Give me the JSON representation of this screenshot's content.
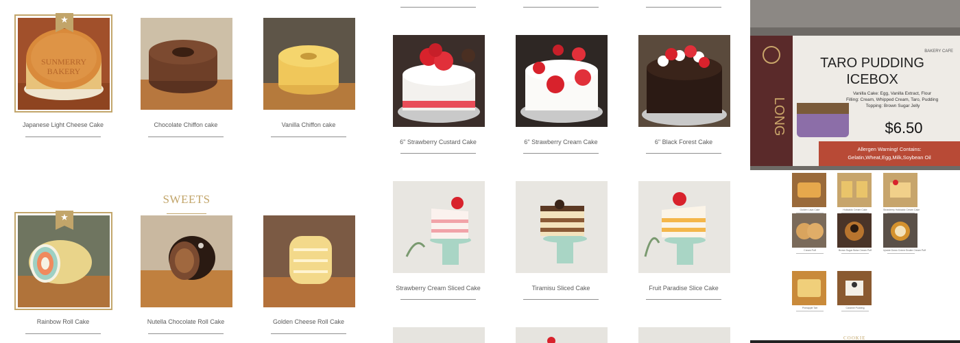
{
  "colors": {
    "gold": "#c2a56a",
    "label_text": "#5a5a5a",
    "rule": "#8e8e8e"
  },
  "panel_a": {
    "section_title": "SWEETS",
    "cards": [
      {
        "label": "Japanese Light Cheese Cake",
        "featured": true,
        "badge_icon": "star-icon",
        "badge": "★"
      },
      {
        "label": "Chocolate Chiffon cake"
      },
      {
        "label": "Vanilla Chiffon cake"
      },
      {
        "label": "Rainbow Roll Cake",
        "featured": true,
        "badge_icon": "star-icon",
        "badge": "★"
      },
      {
        "label": "Nutella Chocolate Roll Cake"
      },
      {
        "label": "Golden Cheese Roll Cake"
      }
    ]
  },
  "panel_b": {
    "cards": [
      {
        "label": "6\" Strawberry Custard Cake"
      },
      {
        "label": "6\" Strawberry Cream Cake"
      },
      {
        "label": "6\" Black Forest Cake"
      },
      {
        "label": "Strawberry Cream Sliced Cake"
      },
      {
        "label": "Tiramisu Sliced Cake"
      },
      {
        "label": "Fruit Paradise Slice Cake"
      }
    ]
  },
  "panel_c": {
    "sign": {
      "brand_vertical": "LONG",
      "brand_top": "BAKERY CAFE",
      "title_line1": "TARO PUDDING",
      "title_line2": "ICEBOX",
      "ingredients": "Vanilla Cake: Egg, Vanilla Extract, Flour\nFilling: Cream, Whipped Cream, Taro, Pudding\nTopping: Brown Sugar Jelly",
      "price": "$6.50",
      "allergen": "Allergen Warning! Contains: Gelatin,Wheat,Egg,Milk,Soybean Oil"
    },
    "mini_cards": [
      {
        "label": "Golden Lava Cake"
      },
      {
        "label": "Hokkaido Cream Cake"
      },
      {
        "label": "Strawberry Hokkaido Cream Cake"
      },
      {
        "label": "Cream Puff"
      },
      {
        "label": "Brown Sugar Boba Cream Puff"
      },
      {
        "label": "Upside Down Creme Brulee Cream Puff"
      },
      {
        "label": "Pineapple Tart"
      },
      {
        "label": "Caramel Pudding"
      }
    ],
    "section_title": "COOKIE"
  }
}
